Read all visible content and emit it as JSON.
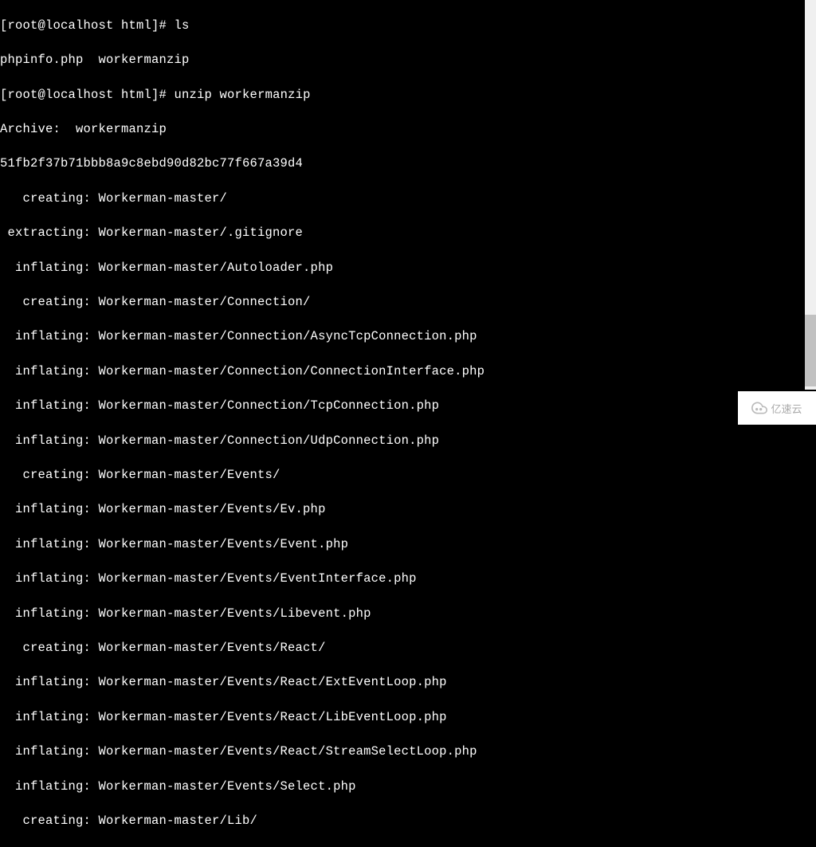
{
  "prompt1": "[root@localhost html]# ",
  "cmd1": "ls",
  "ls_output": "phpinfo.php  workermanzip",
  "prompt2": "[root@localhost html]# ",
  "cmd2": "unzip workermanzip",
  "archive_line": "Archive:  workermanzip",
  "hash_line": "51fb2f37b71bbb8a9c8ebd90d82bc77f667a39d4",
  "lines": [
    "   creating: Workerman-master/",
    " extracting: Workerman-master/.gitignore",
    "  inflating: Workerman-master/Autoloader.php",
    "   creating: Workerman-master/Connection/",
    "  inflating: Workerman-master/Connection/AsyncTcpConnection.php",
    "  inflating: Workerman-master/Connection/ConnectionInterface.php",
    "  inflating: Workerman-master/Connection/TcpConnection.php",
    "  inflating: Workerman-master/Connection/UdpConnection.php",
    "   creating: Workerman-master/Events/",
    "  inflating: Workerman-master/Events/Ev.php",
    "  inflating: Workerman-master/Events/Event.php",
    "  inflating: Workerman-master/Events/EventInterface.php",
    "  inflating: Workerman-master/Events/Libevent.php",
    "   creating: Workerman-master/Events/React/",
    "  inflating: Workerman-master/Events/React/ExtEventLoop.php",
    "  inflating: Workerman-master/Events/React/LibEventLoop.php",
    "  inflating: Workerman-master/Events/React/StreamSelectLoop.php",
    "  inflating: Workerman-master/Events/Select.php",
    "   creating: Workerman-master/Lib/"
  ],
  "watermark_text": "亿速云"
}
